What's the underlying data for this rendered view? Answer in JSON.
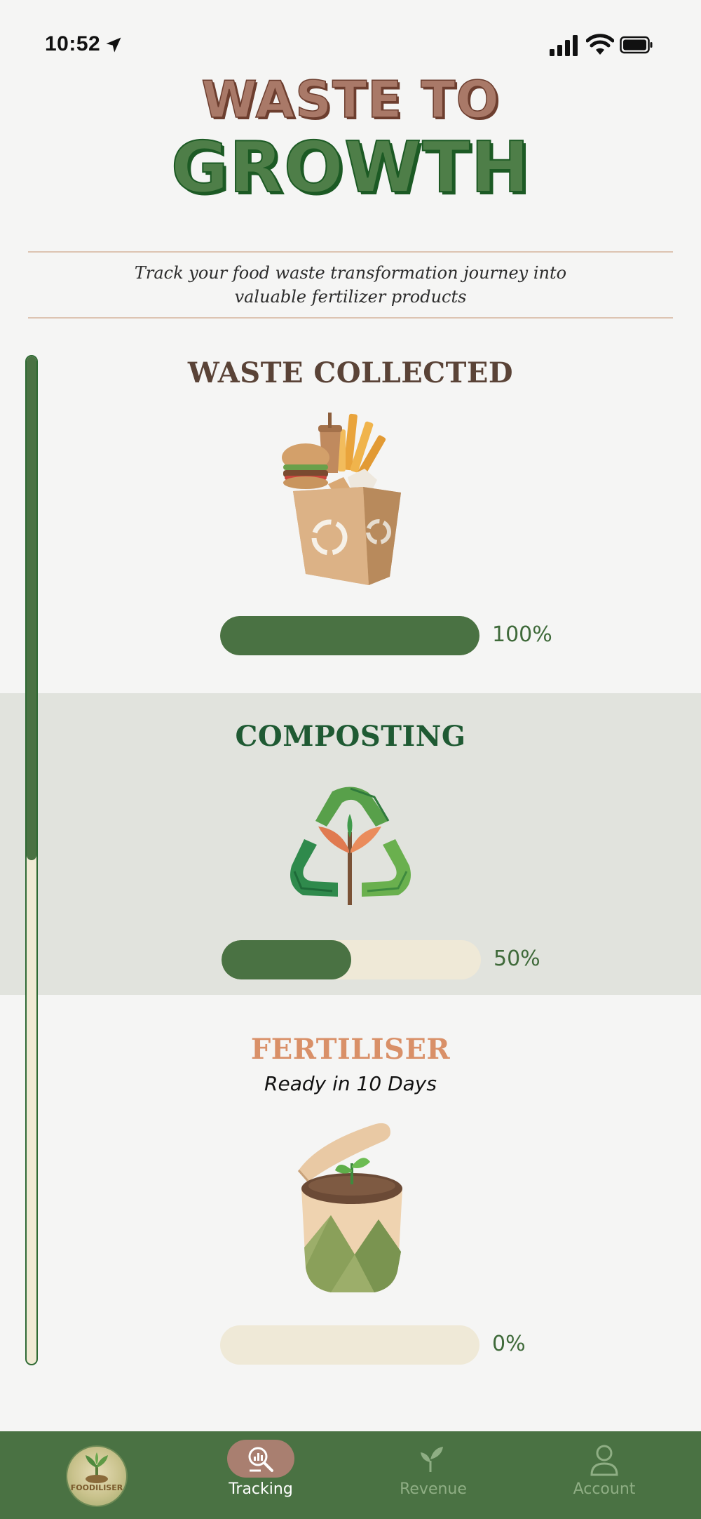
{
  "status_bar": {
    "time": "10:52"
  },
  "header": {
    "title_line1": "WASTE TO",
    "title_line2": "GROWTH",
    "subtitle_line1": "Track your food waste transformation journey into",
    "subtitle_line2": "valuable fertilizer products"
  },
  "overall_progress": 0.5,
  "stages": [
    {
      "title": "WASTE COLLECTED",
      "progress": 1.0,
      "percent_label": "100%",
      "icon": "food-waste-box-icon"
    },
    {
      "title": "COMPOSTING",
      "progress": 0.5,
      "percent_label": "50%",
      "icon": "recycle-leaves-icon"
    },
    {
      "title": "FERTILISER",
      "subtitle": "Ready in 10 Days",
      "progress": 0.0,
      "percent_label": "0%",
      "icon": "sprouting-pot-icon"
    }
  ],
  "nav": {
    "logo_text": "FOODILISER",
    "items": [
      {
        "label": "Tracking",
        "icon": "tracking-icon",
        "active": true
      },
      {
        "label": "Revenue",
        "icon": "sprout-icon",
        "active": false
      },
      {
        "label": "Account",
        "icon": "user-icon",
        "active": false
      }
    ]
  },
  "colors": {
    "primary_green": "#4a7243",
    "track_cream": "#efe9d7",
    "accent_brown": "#a97968",
    "fertiliser_orange": "#d99068",
    "background": "#f5f5f4",
    "band": "#e1e3dd"
  }
}
